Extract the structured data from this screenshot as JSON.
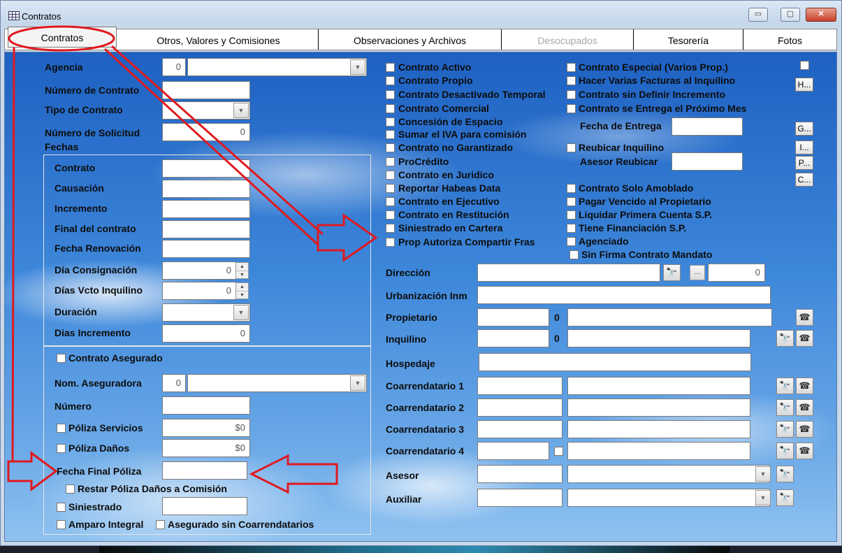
{
  "window": {
    "title": "Contratos",
    "min_label": "▭",
    "max_label": "▢",
    "close_label": "✕"
  },
  "tabs": [
    {
      "label": "Contratos"
    },
    {
      "label": "Otros, Valores y Comisiones"
    },
    {
      "label": "Observaciones y Archivos"
    },
    {
      "label": "Desocupados"
    },
    {
      "label": "Tesorería"
    },
    {
      "label": "Fotos"
    }
  ],
  "left": {
    "agencia": {
      "label": "Agencia",
      "code": "0",
      "name": ""
    },
    "numero_contrato": {
      "label": "Número de Contrato",
      "value": ""
    },
    "tipo_contrato": {
      "label": "Tipo de Contrato",
      "value": ""
    },
    "numero_solicitud": {
      "label": "Número de Solicitud",
      "value": "0"
    },
    "fechas_title": "Fechas",
    "fechas": {
      "contrato": {
        "label": "Contrato",
        "value": ""
      },
      "causacion": {
        "label": "Causación",
        "value": ""
      },
      "incremento": {
        "label": "Incremento",
        "value": ""
      },
      "final_contrato": {
        "label": "Final del contrato",
        "value": ""
      },
      "fecha_renovacion": {
        "label": "Fecha Renovación",
        "value": ""
      },
      "dia_consignacion": {
        "label": "Día Consignación",
        "value": "0"
      },
      "dias_vcto": {
        "label": "Días Vcto Inquilino",
        "value": "0"
      },
      "duracion": {
        "label": "Duración",
        "value": ""
      },
      "dias_incremento": {
        "label": "Dias Incremento",
        "value": "0"
      }
    },
    "seguro": {
      "contrato_asegurado": "Contrato Asegurado",
      "nom_aseguradora": {
        "label": "Nom. Aseguradora",
        "code": "0",
        "name": ""
      },
      "numero": {
        "label": "Número",
        "value": ""
      },
      "poliza_servicios": {
        "label": "Póliza Servicios",
        "value": "$0"
      },
      "poliza_danos": {
        "label": "Póliza Daños",
        "value": "$0"
      },
      "fecha_final_poliza": {
        "label": "Fecha Final Póliza",
        "value": ""
      },
      "restar_poliza": "Restar Póliza Daños a Comisión",
      "siniestrado": {
        "label": "Siniestrado",
        "value": ""
      },
      "amparo_integral": "Amparo Integral",
      "asegurado_sin_coarr": "Asegurado sin Coarrendatarios"
    }
  },
  "checks_col1": [
    "Contrato Activo",
    "Contrato Propio",
    "Contrato Desactivado Temporal",
    "Contrato Comercial",
    "Concesión de Espacio",
    "Sumar el IVA para comisión",
    "Contrato no Garantizado",
    "ProCrédito",
    "Contrato en Juridico",
    "Reportar Habeas Data",
    "Contrato en Ejecutivo",
    "Contrato en Restitución",
    "Siniestrado en Cartera",
    "Prop Autoriza Compartir Fras"
  ],
  "checks_col2_top": [
    "Contrato Especial (Varios Prop.)",
    "Hacer Varias Facturas al Inquilino",
    "Contrato sin Definir Incremento",
    "Contrato se Entrega el Próximo Mes"
  ],
  "fecha_entrega": {
    "label": "Fecha de Entrega",
    "value": ""
  },
  "reubicar": "Reubicar Inquilino",
  "asesor_reubicar": {
    "label": "Asesor Reubicar",
    "value": ""
  },
  "checks_col2_bottom": [
    "Contrato Solo Amoblado",
    "Pagar Vencido al Propietario",
    "Liquidar Primera Cuenta S.P.",
    "Tiene Financiación S.P.",
    "Agenciado",
    "Sin Firma Contrato Mandato"
  ],
  "side_buttons": [
    "H...",
    "G...",
    "I...",
    "P...",
    "C..."
  ],
  "people": {
    "direccion": {
      "label": "Dirección",
      "value": "",
      "code": "0",
      "more": "..."
    },
    "urbanizacion": {
      "label": "Urbanización Inm",
      "value": ""
    },
    "propietario": {
      "label": "Propietario",
      "code": "",
      "num": "0",
      "name": ""
    },
    "inquilino": {
      "label": "Inquilino",
      "code": "",
      "num": "0",
      "name": ""
    },
    "hospedaje": {
      "label": "Hospedaje",
      "value": ""
    },
    "coarrendatario1": {
      "label": "Coarrendatario 1"
    },
    "coarrendatario2": {
      "label": "Coarrendatario 2"
    },
    "coarrendatario3": {
      "label": "Coarrendatario 3"
    },
    "coarrendatario4": {
      "label": "Coarrendatario 4"
    },
    "asesor": {
      "label": "Asesor"
    },
    "auxiliar": {
      "label": "Auxiliar"
    }
  },
  "icons": {
    "binoculars": "🔭",
    "phone": "☎"
  },
  "annotation_color": "#e0191f"
}
